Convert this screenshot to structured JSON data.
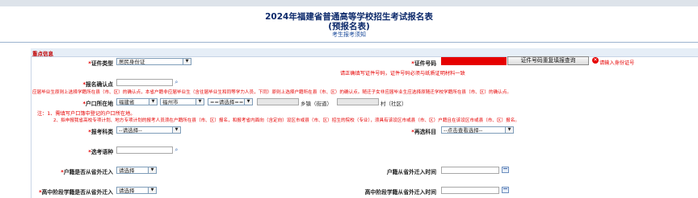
{
  "header": {
    "title": "2024年福建省普通高等学校招生考试报名表",
    "subtitle": "(预报名表)",
    "notice_link": "考生报考须知"
  },
  "section": {
    "title": "重点信息"
  },
  "fields": {
    "id_type": {
      "label": "证件类型",
      "value": "居民身份证"
    },
    "id_number": {
      "label": "证件号码",
      "check_button": "证件号码重复填报查询",
      "error": "请输入身份证号"
    },
    "id_hint": "请正确填写证件号码，证件号码必须与纸质证明材料一致",
    "confirm_point": {
      "label": "报名确认点"
    },
    "confirm_note": "应届毕业生原则上选择学籍所在县（市、区）的确认点，本省户籍非应届毕业生（含往届毕业生和同等学力人员，下同）原则上选择户籍所在县（市、区）的确认点。随迁子女非应届毕业生应选择原随迁学校学籍所在县（市、区）的确认点。",
    "household": {
      "label": "户口所在地",
      "province": "福建省",
      "city": "福州市",
      "county": "==请选择==",
      "town_suffix": "乡镇（街道）",
      "village_suffix": "村（社区）"
    },
    "notes": [
      "注：1、需填写户口簿中登记的户口所在地。",
      "2、拟申报我省高校专项计划、地方专项计划的报考人员须在户籍所在县（市、区）报名，和报考省内面向（含定向）设区市或县（市、区）招生的院校（专业），须具有该设区市或县（市、区）户籍且在该设区市或县（市、区）报名。"
    ],
    "exam_type": {
      "label": "报考科类",
      "value": "--请选择--"
    },
    "elective": {
      "label": "再选科目",
      "value": "--点击查看选择--"
    },
    "language": {
      "label": "选考语种"
    },
    "migrate_out": {
      "label": "户籍是否从省外迁入",
      "value": "请选择"
    },
    "migrate_time": {
      "label": "户籍从省外迁入时间"
    },
    "hs_migrate_out": {
      "label": "高中阶段学籍是否从省外迁入",
      "value": "请选择"
    },
    "hs_migrate_time": {
      "label": "高中阶段学籍从省外迁入时间"
    }
  },
  "icons": {
    "search": "search-icon",
    "calendar": "calendar-icon",
    "dropdown": "chevron-down-icon",
    "error": "error-icon"
  },
  "colors": {
    "required": "#e60000",
    "title": "#0d2a6b",
    "section_bg": "#e6eef7"
  }
}
